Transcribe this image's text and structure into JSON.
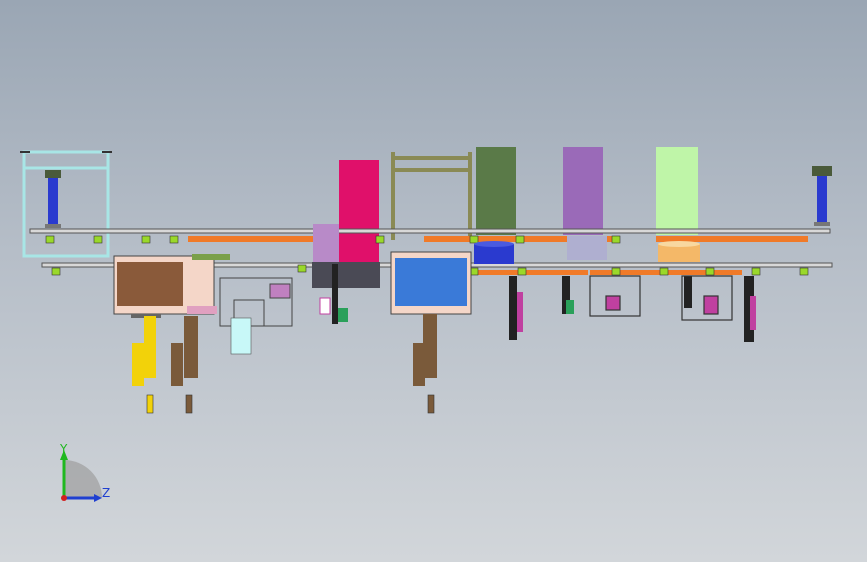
{
  "viewport": {
    "background_top": "#9aa6b4",
    "background_bottom": "#d2d6da"
  },
  "triad": {
    "y_label": "Y",
    "z_label": "Z",
    "y_color": "#1fb81f",
    "z_color": "#1f3fd0",
    "origin_color": "#d21f1f"
  },
  "colors": {
    "frame_cyan": "#a8e6e6",
    "frame_olive": "#8a8a55",
    "block_magenta": "#e0106a",
    "block_green": "#5a7a48",
    "block_purple": "#9a6ab8",
    "block_mint": "#bff5a8",
    "rail_orange": "#f07a28",
    "cylinder_blue": "#2a3acf",
    "cylinder_yellow": "#f2d20a",
    "cylinder_brown": "#7a5a3a",
    "panel_blue": "#3a7ad8",
    "dark_gray": "#4a4a55",
    "lime": "#9ad82a"
  }
}
